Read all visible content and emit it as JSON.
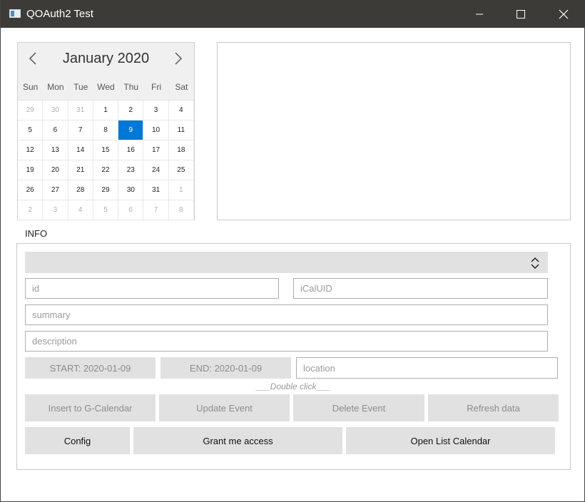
{
  "window": {
    "title": "QOAuth2 Test"
  },
  "calendar": {
    "month_label": "January 2020",
    "weekdays": [
      "Sun",
      "Mon",
      "Tue",
      "Wed",
      "Thu",
      "Fri",
      "Sat"
    ],
    "weeks": [
      [
        "29",
        "30",
        "31",
        "1",
        "2",
        "3",
        "4"
      ],
      [
        "5",
        "6",
        "7",
        "8",
        "9",
        "10",
        "11"
      ],
      [
        "12",
        "13",
        "14",
        "15",
        "16",
        "17",
        "18"
      ],
      [
        "19",
        "20",
        "21",
        "22",
        "23",
        "24",
        "25"
      ],
      [
        "26",
        "27",
        "28",
        "29",
        "30",
        "31",
        "1"
      ],
      [
        "2",
        "3",
        "4",
        "5",
        "6",
        "7",
        "8"
      ]
    ],
    "selected": "9",
    "selected_color": "#0078d7"
  },
  "info": {
    "label": "INFO",
    "id_placeholder": "id",
    "icaluid_placeholder": "iCalUID",
    "summary_placeholder": "summary",
    "description_placeholder": "description",
    "location_placeholder": "location",
    "start_label": "START: 2020-01-09",
    "end_label": "END: 2020-01-09",
    "double_click_hint": "___Double click___"
  },
  "actions": {
    "insert": "Insert to G-Calendar",
    "update": "Update Event",
    "delete": "Delete Event",
    "refresh": "Refresh data",
    "config": "Config",
    "grant": "Grant me access",
    "open_list": "Open List Calendar"
  }
}
